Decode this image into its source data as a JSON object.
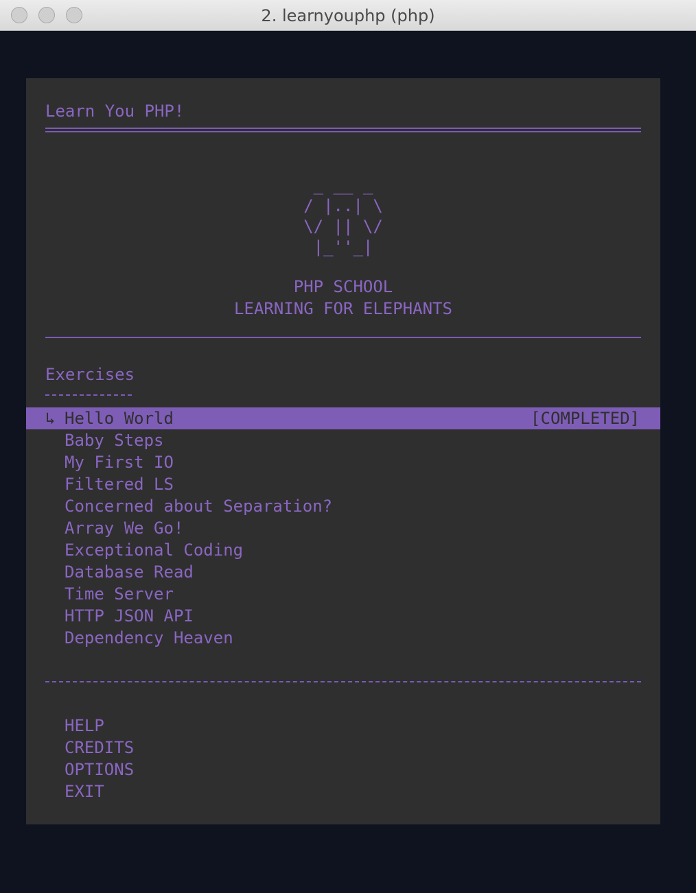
{
  "window": {
    "title": "2. learnyouphp (php)"
  },
  "header": {
    "title": "Learn You PHP!",
    "logo": [
      " _ __ _ ",
      "/ |..| \\",
      "\\/ || \\/",
      " |_''_| "
    ],
    "school": "PHP SCHOOL",
    "tagline": "LEARNING FOR ELEPHANTS"
  },
  "exercises": {
    "heading": "Exercises",
    "selected_marker": "↳",
    "items": [
      {
        "label": "Hello World",
        "status": "[COMPLETED]"
      },
      {
        "label": "Baby Steps",
        "status": ""
      },
      {
        "label": "My First IO",
        "status": ""
      },
      {
        "label": "Filtered LS",
        "status": ""
      },
      {
        "label": "Concerned about Separation?",
        "status": ""
      },
      {
        "label": "Array We Go!",
        "status": ""
      },
      {
        "label": "Exceptional Coding",
        "status": ""
      },
      {
        "label": "Database Read",
        "status": ""
      },
      {
        "label": "Time Server",
        "status": ""
      },
      {
        "label": "HTTP JSON API",
        "status": ""
      },
      {
        "label": "Dependency Heaven",
        "status": ""
      }
    ]
  },
  "footer_menu": {
    "items": [
      "HELP",
      "CREDITS",
      "OPTIONS",
      "EXIT"
    ]
  },
  "colors": {
    "accent": "#8a66c2",
    "highlight": "#7e5db6",
    "terminal_bg": "#2f2f2f",
    "outer_bg": "#0f1320"
  }
}
